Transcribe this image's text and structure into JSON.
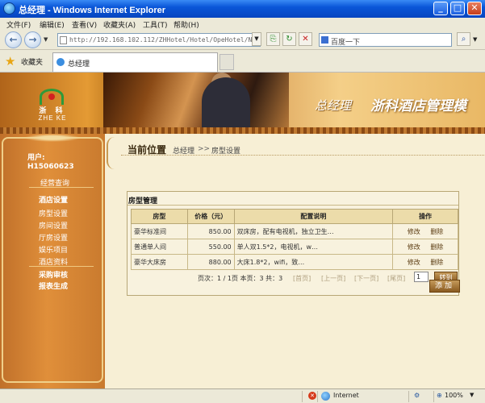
{
  "window": {
    "title": "总经理 - Windows Internet Explorer",
    "min_glyph": "_",
    "max_glyph": "□",
    "close_glyph": "✕"
  },
  "menu": [
    "文件(F)",
    "编辑(E)",
    "查看(V)",
    "收藏夹(A)",
    "工具(T)",
    "帮助(H)"
  ],
  "address": {
    "url": "http://192.168.102.112/ZHHotel/Hotel/OpeHotel/Nopa",
    "search_placeholder": "百度一下"
  },
  "favorites": {
    "label": "收藏夹",
    "tab_title": "总经理"
  },
  "banner": {
    "logo_cn": "浙 科",
    "logo_en": "ZHE KE",
    "role": "总经理",
    "system_title": "浙科酒店管理模"
  },
  "sidebar": {
    "user_label": "用户:",
    "user_id": "H15060623",
    "items": [
      "经营查询",
      "酒店设置",
      "房型设置",
      "房间设置",
      "厅房设置",
      "娱乐项目",
      "酒店资料",
      "采购审核",
      "报表生成"
    ]
  },
  "breadcrumb": {
    "title": "当前位置",
    "level1": "总经理",
    "separator": ">>",
    "level2": "房型设置"
  },
  "panel": {
    "title": "房型管理",
    "columns": [
      "房型",
      "价格（元）",
      "配置说明",
      "操作"
    ],
    "rows": [
      {
        "type": "豪华标准间",
        "price": "850.00",
        "desc": "双床房，配有电视机，独立卫生…",
        "edit": "修改",
        "delete": "删除"
      },
      {
        "type": "普通单人间",
        "price": "550.00",
        "desc": "单人双1.5*2，电视机，w…",
        "edit": "修改",
        "delete": "删除"
      },
      {
        "type": "豪华大床房",
        "price": "880.00",
        "desc": "大床1.8*2，wifi，致…",
        "edit": "修改",
        "delete": "删除"
      }
    ],
    "pager": {
      "summary": "页次：1 / 1页  本页：3  共：3",
      "first": "[首页]",
      "prev": "[上一页]",
      "next": "[下一页]",
      "last": "[尾页]",
      "page_value": "1",
      "goto": "转到"
    },
    "add_button": "添加"
  },
  "status": {
    "zone": "Internet",
    "zoom": "100%"
  }
}
